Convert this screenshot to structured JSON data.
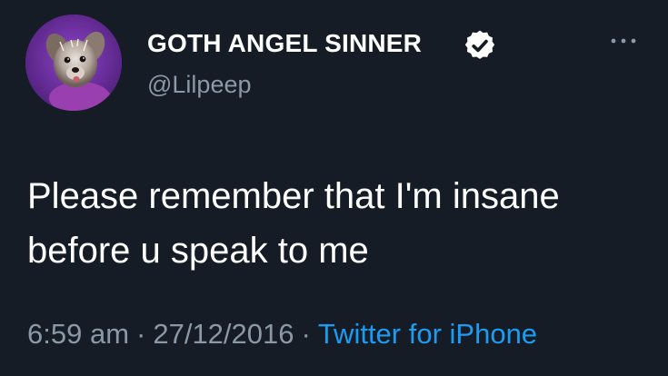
{
  "user": {
    "display_name": "GOTH ANGEL SINNER",
    "handle": "@Lilpeep",
    "verified": true,
    "avatar_icon": "dog-avatar-icon"
  },
  "tweet": {
    "text": "Please remember that I'm insane\nbefore u speak to me",
    "time": "6:59 am",
    "date": "27/12/2016",
    "source": "Twitter for iPhone",
    "separator": "·"
  },
  "icons": {
    "verified": "verified-badge-icon",
    "more": "more-options-icon"
  },
  "colors": {
    "background": "#151c26",
    "text_primary": "#ffffff",
    "text_secondary": "#8b98a5",
    "accent": "#1d9bf0",
    "avatar_background": "#6a2f9c"
  }
}
